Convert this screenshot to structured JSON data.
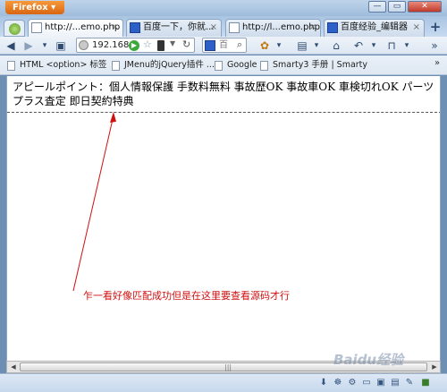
{
  "window": {
    "app_button": "Firefox",
    "controls": {
      "minimize": "—",
      "restore": "▭",
      "close": "✕"
    }
  },
  "tabs": [
    {
      "label": "http://...emo.php",
      "active": true
    },
    {
      "label": "百度一下，你就...",
      "active": false
    },
    {
      "label": "http://l...emo.php",
      "active": false
    },
    {
      "label": "百度经验_编辑器",
      "active": false
    }
  ],
  "navbar": {
    "url": "192.168.",
    "search_placeholder": "百"
  },
  "bookmarks": [
    "HTML <option> 标签",
    "JMenu的jQuery插件 ...",
    "Google",
    "Smarty3 手册 | Smarty"
  ],
  "page": {
    "line1": "アピールポイント：個人情報保護 手数料無料 事故歴OK 事故車OK 車検切れOK パーツ",
    "line2": "プラス査定 即日契約特典"
  },
  "annotation": {
    "text": "乍一看好像匹配成功但是在这里要查看源码才行",
    "color": "#d01010"
  },
  "watermark": "Baidu经验"
}
